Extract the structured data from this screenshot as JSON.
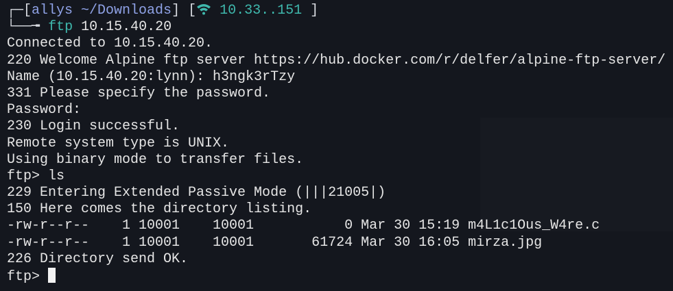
{
  "prompt": {
    "user_path": "allys ~/Downloads",
    "ip": "10.33..151",
    "command": "ftp",
    "command_args": " 10.15.40.20"
  },
  "output": [
    "Connected to 10.15.40.20.",
    "220 Welcome Alpine ftp server https://hub.docker.com/r/delfer/alpine-ftp-server/",
    "Name (10.15.40.20:lynn): h3ngk3rTzy",
    "331 Please specify the password.",
    "Password:",
    "230 Login successful.",
    "Remote system type is UNIX.",
    "Using binary mode to transfer files.",
    "ftp> ls",
    "229 Entering Extended Passive Mode (|||21005|)",
    "150 Here comes the directory listing.",
    "-rw-r--r--    1 10001    10001           0 Mar 30 15:19 m4L1c1Ous_W4re.c",
    "-rw-r--r--    1 10001    10001       61724 Mar 30 16:05 mirza.jpg",
    "226 Directory send OK."
  ],
  "input_prompt": "ftp> ",
  "colors": {
    "background": "#14171e",
    "text": "#e6e6e6",
    "user_path": "#8fa2e6",
    "ip": "#3fb8ad",
    "cursor": "#f2f2f2"
  },
  "icons": {
    "network": "wifi-icon"
  }
}
